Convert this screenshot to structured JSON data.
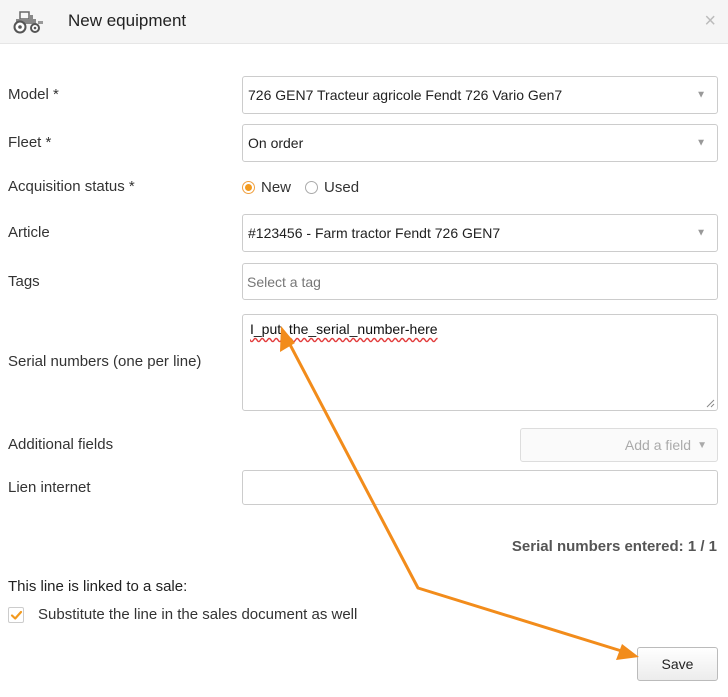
{
  "dialog": {
    "title": "New equipment",
    "header_icon": "tractor-icon",
    "close_label": "×"
  },
  "form": {
    "model": {
      "label": "Model *",
      "value": "726 GEN7 Tracteur agricole Fendt 726 Vario Gen7"
    },
    "fleet": {
      "label": "Fleet *",
      "value": "On order"
    },
    "acquisition_status": {
      "label": "Acquisition status *",
      "options": [
        {
          "label": "New",
          "selected": true
        },
        {
          "label": "Used",
          "selected": false
        }
      ]
    },
    "article": {
      "label": "Article",
      "value": "#123456 - Farm tractor Fendt 726 GEN7"
    },
    "tags": {
      "label": "Tags",
      "placeholder": "Select a tag"
    },
    "serial_numbers": {
      "label": "Serial numbers (one per line)",
      "value": "I_put_the_serial_number-here"
    },
    "additional_fields": {
      "label": "Additional fields",
      "button_label": "Add a field"
    },
    "lien_internet": {
      "label": "Lien internet",
      "value": ""
    }
  },
  "summary": {
    "text": "Serial numbers entered: 1 / 1"
  },
  "sale_link": {
    "text": "This line is linked to a sale:",
    "checkbox_label": "Substitute the line in the sales document as well",
    "checked": true
  },
  "actions": {
    "save_label": "Save"
  },
  "colors": {
    "accent": "#f39a1e",
    "annotation_arrow": "#f28c1b",
    "spellcheck": "#e23b3b"
  }
}
